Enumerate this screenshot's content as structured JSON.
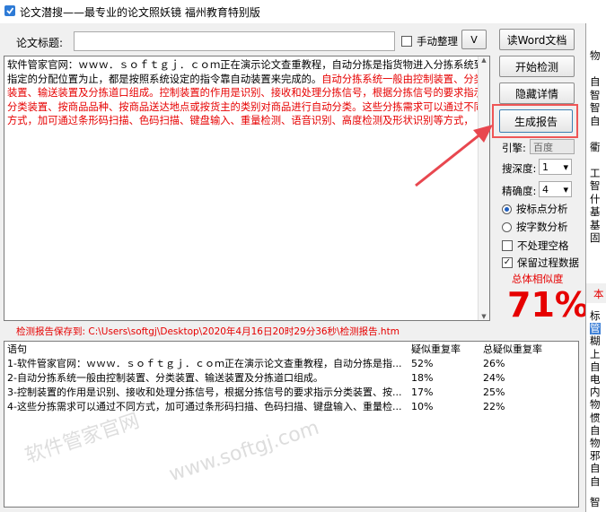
{
  "window": {
    "title": "论文潜搜——最专业的论文照妖镜 福州教育特别版"
  },
  "form": {
    "title_label": "论文标题:",
    "title_value": "",
    "manual_label": "手动整理",
    "dropdown_glyph": "V"
  },
  "content": {
    "black_text": "软件管家官网：ｗｗｗ．ｓｏｆｔｇｊ．ｃｏｍ正在演示论文查重教程，自动分拣是指货物进入分拣系统到指定的分配位置为止，都是按照系统设定的指令靠自动装置来完成的。",
    "red_text": "自动分拣系统一般由控制装置、分类装置、输送装置及分拣道口组成。控制装置的作用是识别、接收和处理分拣信号，根据分拣信号的要求指示分类装置、按商品品种、按商品送达地点或按货主的类别对商品进行自动分类。这些分拣需求可以通过不同方式，加可通过条形码扫描、色码扫描、键盘输入、重量检测、语音识别、高度检测及形状识别等方式，"
  },
  "buttons": {
    "read_word": "读Word文档",
    "start_check": "开始检测",
    "hide_details": "隐藏详情",
    "generate_report": "生成报告"
  },
  "options": {
    "engine_label": "引擎:",
    "engine_value": "百度",
    "depth_label": "搜深度:",
    "depth_value": "1",
    "precision_label": "精确度:",
    "precision_value": "4",
    "radio_punct": "按标点分析",
    "radio_chars": "按字数分析",
    "chk_no_blank": "不处理空格",
    "chk_keep_data": "保留过程数据",
    "chk_keep_mark": "✓",
    "similarity_label": "总体相似度",
    "similarity_value": "71%",
    "similarity_percent": 71
  },
  "report_path": "检测报告保存到: C:\\Users\\softgj\\Desktop\\2020年4月16日20时29分36秒\\检测报告.htm",
  "results": {
    "headers": [
      "语句",
      "疑似重复率",
      "总疑似重复率"
    ],
    "rows": [
      [
        "1-软件管家官网：ｗｗｗ．ｓｏｆｔｇｊ．ｃｏｍ正在演示论文查重教程，自动分拣是指...",
        "52%",
        "26%"
      ],
      [
        "2-自动分拣系统一般由控制装置、分类装置、输送装置及分拣道口组成。",
        "18%",
        "24%"
      ],
      [
        "3-控制装置的作用是识别、接收和处理分拣信号，根据分拣信号的要求指示分类装置、按...",
        "17%",
        "25%"
      ],
      [
        "4-这些分拣需求可以通过不同方式，加可通过条形码扫描、色码扫描、键盘输入、重量检...",
        "10%",
        "22%"
      ]
    ]
  },
  "right_panel": {
    "upper_lines": [
      "物",
      "",
      "自",
      "智",
      "智",
      "自",
      "",
      "衢",
      "",
      "工",
      "智",
      "什",
      "基",
      "基",
      "固"
    ],
    "middle_line": "本",
    "lower_lines": [
      "标",
      "管",
      "糊",
      "上",
      "自",
      "电",
      "内",
      "物",
      "惯",
      "自",
      "物",
      "邪",
      "自",
      "自"
    ],
    "bottom_line": "智"
  },
  "watermark": [
    "软件管家官网",
    "www.softgj.com"
  ],
  "colors": {
    "accent_red": "#e60000",
    "link_blue": "#1f5fbf",
    "arrow_red": "#e8474f"
  }
}
